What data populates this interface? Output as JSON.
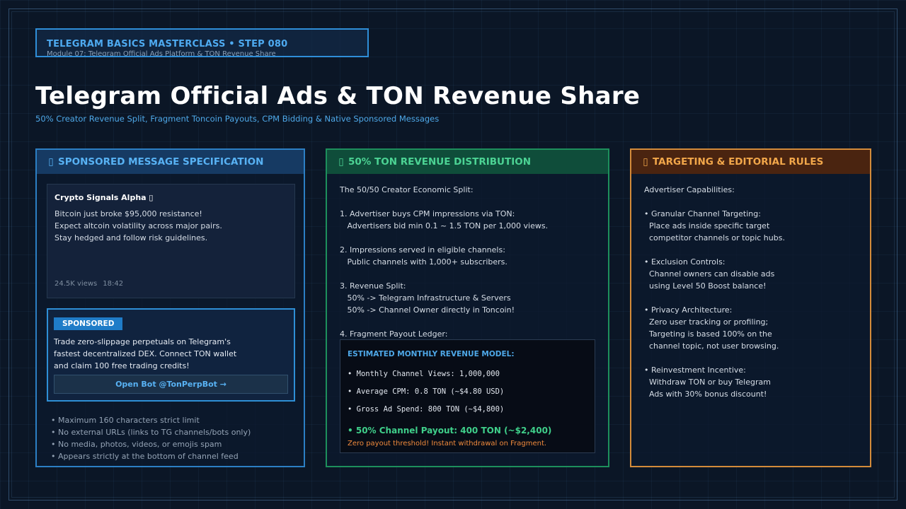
{
  "header": {
    "step_label": "TELEGRAM BASICS MASTERCLASS • STEP 080",
    "module_label": "Module 07: Telegram Official Ads Platform & TON Revenue Share",
    "title": "Telegram Official Ads & TON Revenue Share",
    "subtitle": "50% Creator Revenue Split, Fragment Toncoin Payouts, CPM Bidding & Native Sponsored Messages"
  },
  "colors": {
    "blue_accent": "#2c7fc4",
    "green_accent": "#1d8f5c",
    "orange_accent": "#d38b3a",
    "payout_green": "#3fcf8a",
    "note_orange": "#f08a3c"
  },
  "panel_spec": {
    "icon": "megaphone-icon",
    "icon_glyph": "▯",
    "title": "SPONSORED MESSAGE SPECIFICATION",
    "message": {
      "channel": "Crypto Signals Alpha",
      "channel_icon_glyph": "▯",
      "lines": [
        "Bitcoin just broke $95,000 resistance!",
        "Expect altcoin volatility across major pairs.",
        "Stay hedged and follow risk guidelines."
      ],
      "views": "24.5K views",
      "time": "18:42"
    },
    "sponsored": {
      "badge": "SPONSORED",
      "lines": [
        "Trade zero-slippage perpetuals on Telegram's",
        "fastest decentralized DEX. Connect TON wallet",
        "and claim 100 free trading credits!"
      ],
      "button": "Open Bot @TonPerpBot →"
    },
    "rules": [
      "• Maximum 160 characters strict limit",
      "• No external URLs (links to TG channels/bots only)",
      "• No media, photos, videos, or emojis spam",
      "• Appears strictly at the bottom of channel feed"
    ]
  },
  "panel_revenue": {
    "icon": "coin-icon",
    "icon_glyph": "▯",
    "title": "50% TON REVENUE DISTRIBUTION",
    "lines": [
      "The 50/50 Creator Economic Split:",
      "",
      "1. Advertiser buys CPM impressions via TON:",
      "   Advertisers bid min 0.1 ~ 1.5 TON per 1,000 views.",
      "",
      "2. Impressions served in eligible channels:",
      "   Public channels with 1,000+ subscribers.",
      "",
      "3. Revenue Split:",
      "   50% -> Telegram Infrastructure & Servers",
      "   50% -> Channel Owner directly in Toncoin!",
      "",
      "4. Fragment Payout Ledger:"
    ],
    "model": {
      "title": "ESTIMATED MONTHLY REVENUE MODEL:",
      "items": [
        "• Monthly Channel Views: 1,000,000",
        "• Average CPM: 0.8 TON (~$4.80 USD)",
        "• Gross Ad Spend: 800 TON (~$4,800)"
      ],
      "payout": "• 50% Channel Payout: 400 TON (~$2,400)",
      "note": "Zero payout threshold! Instant withdrawal on Fragment."
    }
  },
  "panel_targeting": {
    "icon": "target-icon",
    "icon_glyph": "▯",
    "title": "TARGETING & EDITORIAL RULES",
    "lines": [
      "Advertiser Capabilities:",
      "",
      "• Granular Channel Targeting:",
      "  Place ads inside specific target",
      "  competitor channels or topic hubs.",
      "",
      "• Exclusion Controls:",
      "  Channel owners can disable ads",
      "  using Level 50 Boost balance!",
      "",
      "• Privacy Architecture:",
      "  Zero user tracking or profiling;",
      "  Targeting is based 100% on the",
      "  channel topic, not user browsing.",
      "",
      "• Reinvestment Incentive:",
      "  Withdraw TON or buy Telegram",
      "  Ads with 30% bonus discount!"
    ]
  }
}
